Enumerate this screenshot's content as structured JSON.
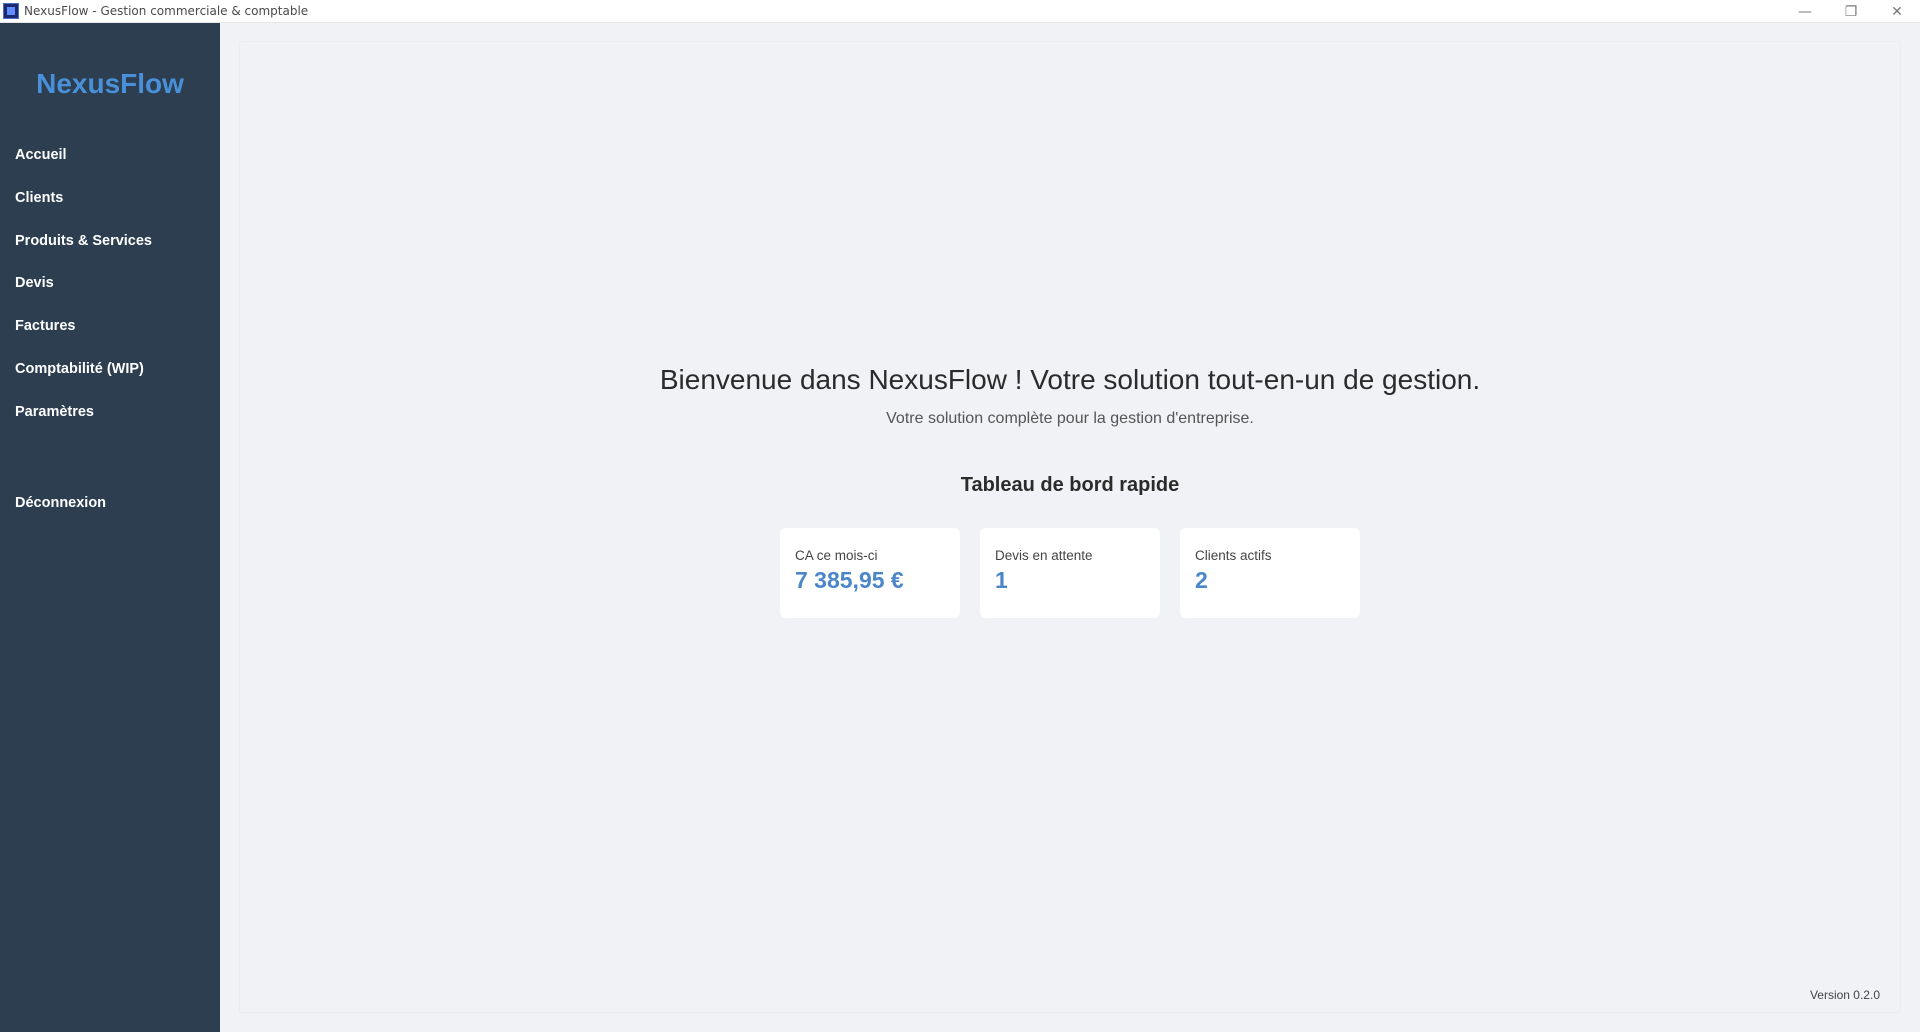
{
  "window": {
    "title": "NexusFlow - Gestion commerciale & comptable",
    "minimize": "—",
    "maximize": "❐",
    "close": "✕"
  },
  "sidebar": {
    "brand": "NexusFlow",
    "items": [
      {
        "label": "Accueil"
      },
      {
        "label": "Clients"
      },
      {
        "label": "Produits & Services"
      },
      {
        "label": "Devis"
      },
      {
        "label": "Factures"
      },
      {
        "label": "Comptabilité (WIP)"
      },
      {
        "label": "Paramètres"
      }
    ],
    "logout": "Déconnexion"
  },
  "main": {
    "welcome": "Bienvenue dans NexusFlow ! Votre solution tout-en-un de gestion.",
    "subtitle": "Votre solution complète pour la gestion d'entreprise.",
    "dashboard_title": "Tableau de bord rapide",
    "cards": [
      {
        "label": "CA ce mois-ci",
        "value": "7 385,95 €"
      },
      {
        "label": "Devis en attente",
        "value": "1"
      },
      {
        "label": "Clients actifs",
        "value": "2"
      }
    ],
    "version": "Version 0.2.0"
  },
  "colors": {
    "sidebar_bg": "#2c3e50",
    "accent": "#4a90d9",
    "main_bg": "#f0f2f5",
    "card_bg": "#ffffff"
  }
}
